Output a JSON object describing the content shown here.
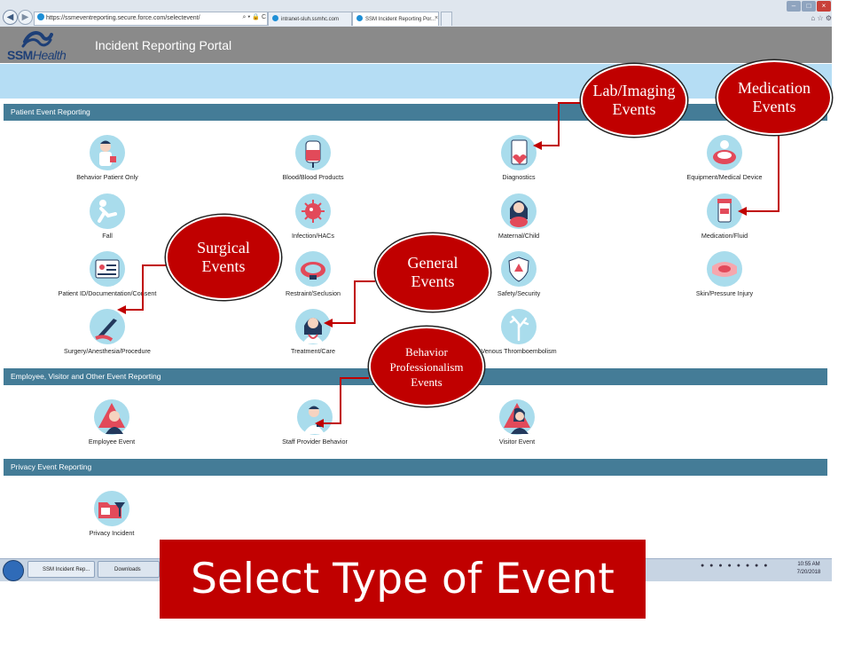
{
  "browser": {
    "url": "https://ssmeventreporting.secure.force.com/selectevent/",
    "url_bold_part": "force.com",
    "address_icons": "⌕ ▾ 🔒 C",
    "tabs": [
      {
        "label": "intranet-sluh.ssmhc.com"
      },
      {
        "label": "SSM Incident Reporting Por..."
      }
    ],
    "tab_close": "×",
    "window_buttons": {
      "min": "–",
      "max": "□",
      "close": "×"
    },
    "toolbar_icons": "⌂ ☆ ⚙",
    "back": "◀",
    "forward": "▶"
  },
  "header": {
    "logo_bold": "SSM",
    "logo_light": "Health",
    "title": "Incident Reporting Portal"
  },
  "sections": {
    "patient": "Patient Event Reporting",
    "employee": "Employee, Visitor and Other Event Reporting",
    "privacy": "Privacy Event Reporting"
  },
  "items": {
    "behavior_patient_only": "Behavior Patient Only",
    "blood_products": "Blood/Blood Products",
    "diagnostics": "Diagnostics",
    "equipment_device": "Equipment/Medical Device",
    "fall": "Fall",
    "infection_hacs": "Infection/HACs",
    "maternal_child": "Maternal/Child",
    "medication_fluid": "Medication/Fluid",
    "patient_id_doc": "Patient ID/Documentation/Consent",
    "restraint_seclusion": "Restraint/Seclusion",
    "safety_security": "Safety/Security",
    "skin_pressure": "Skin/Pressure Injury",
    "surgery_anesthesia": "Surgery/Anesthesia/Procedure",
    "treatment_care": "Treatment/Care",
    "venous_thrombo": "Venous Thromboembolism",
    "employee_event": "Employee Event",
    "staff_provider_behavior": "Staff Provider Behavior",
    "visitor_event": "Visitor Event",
    "privacy_incident": "Privacy Incident"
  },
  "taskbar": {
    "ie_task": "SSM Incident Rep...",
    "folder_task": "Downloads",
    "tray": "● ● ● ● ● ● ● ●",
    "time": "10:55 AM",
    "date": "7/20/2018"
  },
  "annotations": {
    "select_banner": "Select Type of Event",
    "lab_imaging": "Lab/Imaging\nEvents",
    "medication": "Medication\nEvents",
    "surgical": "Surgical\nEvents",
    "general": "General\nEvents",
    "behavior_prof": "Behavior\nProfessionalism\nEvents"
  },
  "colors": {
    "section_bar": "#447c97",
    "banner": "#b5ddf4",
    "header": "#8a8a8a",
    "callout": "#c00000",
    "icon_bg": "#a9dcec"
  }
}
